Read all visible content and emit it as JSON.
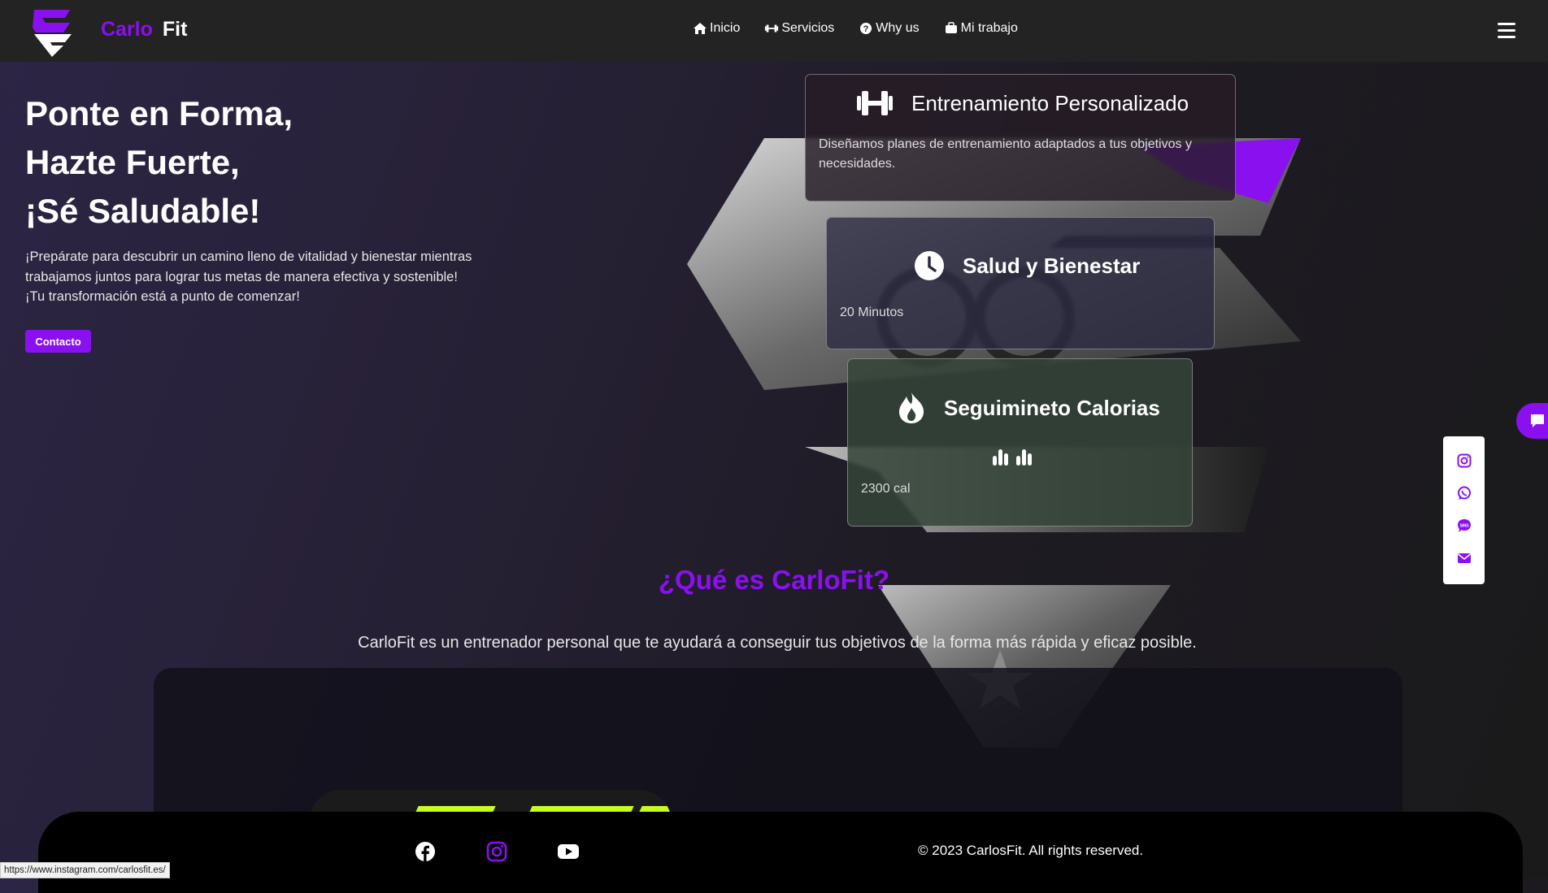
{
  "header": {
    "brand_part1": "Carlo",
    "brand_part2": "Fit",
    "nav": [
      {
        "label": "Inicio",
        "icon": "home-icon"
      },
      {
        "label": "Servicios",
        "icon": "dumbbell-icon"
      },
      {
        "label": "Why us",
        "icon": "question-circle-icon"
      },
      {
        "label": "Mi trabajo",
        "icon": "briefcase-icon"
      }
    ],
    "menu_icon": "hamburger-icon"
  },
  "hero": {
    "title_lines": [
      "Ponte en Forma,",
      "Hazte Fuerte,",
      "¡Sé Saludable!"
    ],
    "text": "¡Prepárate para descubrir un camino lleno de vitalidad y bienestar mientras trabajamos juntos para lograr tus metas de manera efectiva y sostenible! ¡Tu transformación está a punto de comenzar!",
    "button_label": "Contacto"
  },
  "cards": [
    {
      "title": "Entrenamiento Personalizado",
      "icon": "dumbbell-icon",
      "text": "Diseñamos planes de entrenamiento adaptados a tus objetivos y necesidades."
    },
    {
      "title": "Salud y Bienestar",
      "icon": "clock-icon",
      "meta": "20 Minutos"
    },
    {
      "title": "Seguimineto Calorias",
      "icon": "flame-icon",
      "meta": "2300 cal"
    }
  ],
  "about": {
    "title": "¿Qué es CarloFit?",
    "text": "CarloFit es un entrenador personal que te ayudará a conseguir tus objetivos de la forma más rápida y eficaz posible."
  },
  "footer": {
    "icons": [
      "facebook-icon",
      "instagram-icon",
      "youtube-icon"
    ],
    "copyright": "© 2023 CarlosFit. All rights reserved."
  },
  "social_float": [
    "instagram-icon",
    "whatsapp-icon",
    "sms-icon",
    "email-icon"
  ],
  "status_url": "https://www.instagram.com/carlosfit.es/",
  "colors": {
    "accent": "#8a10f0",
    "header_bg": "#232323",
    "footer_bg": "#000000"
  }
}
